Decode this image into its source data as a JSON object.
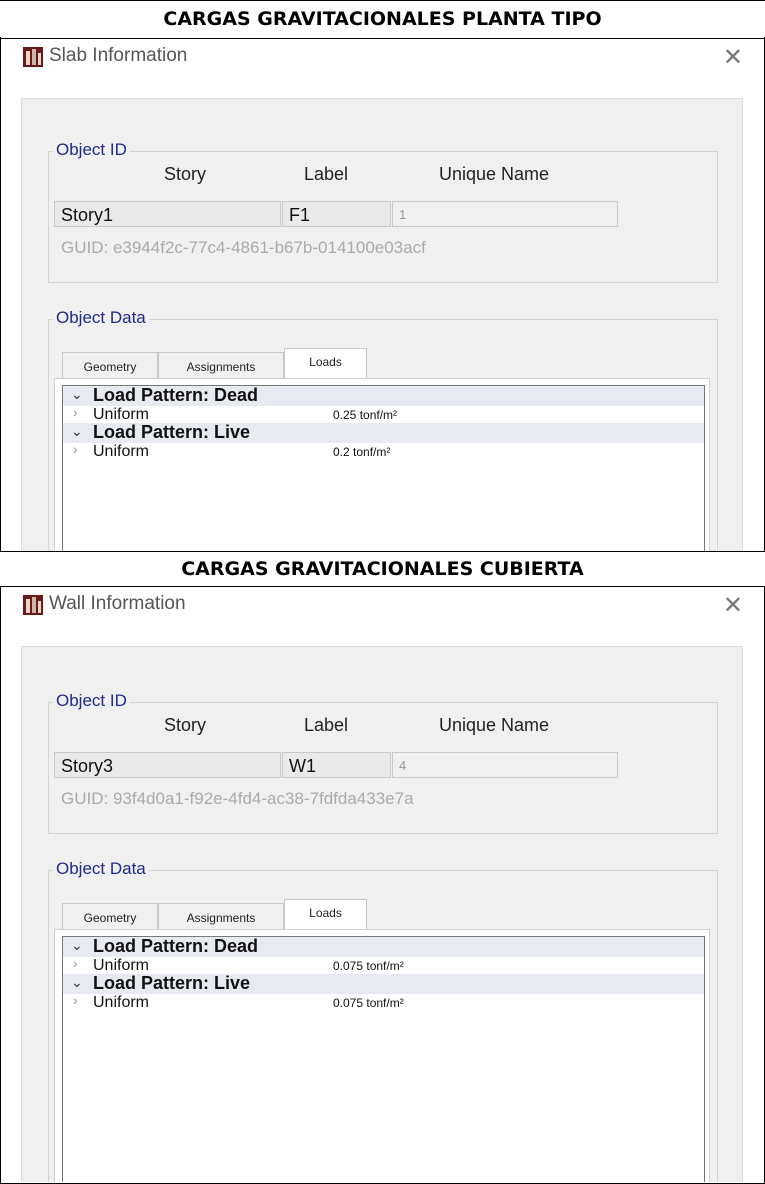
{
  "sections": [
    {
      "header": "CARGAS GRAVITACIONALES PLANTA TIPO",
      "window_title": "Slab Information",
      "close_glyph": "✕",
      "object_id": {
        "group_title": "Object ID",
        "col_story": "Story",
        "col_label": "Label",
        "col_unique": "Unique Name",
        "story": "Story1",
        "label": "F1",
        "unique_name": "1",
        "guid": "GUID:  e3944f2c-77c4-4861-b67b-014100e03acf"
      },
      "object_data": {
        "group_title": "Object Data",
        "tabs": [
          "Geometry",
          "Assignments",
          "Loads"
        ],
        "active_tab": "Loads",
        "rows": [
          {
            "type": "pattern",
            "text": "Load Pattern: Dead"
          },
          {
            "type": "item",
            "text": "Uniform",
            "value": "0.25 tonf/m²"
          },
          {
            "type": "pattern",
            "text": "Load Pattern: Live"
          },
          {
            "type": "item",
            "text": "Uniform",
            "value": "0.2 tonf/m²"
          }
        ]
      }
    },
    {
      "header": "CARGAS GRAVITACIONALES CUBIERTA",
      "window_title": "Wall Information",
      "close_glyph": "✕",
      "object_id": {
        "group_title": "Object ID",
        "col_story": "Story",
        "col_label": "Label",
        "col_unique": "Unique Name",
        "story": "Story3",
        "label": "W1",
        "unique_name": "4",
        "guid": "GUID:  93f4d0a1-f92e-4fd4-ac38-7fdfda433e7a"
      },
      "object_data": {
        "group_title": "Object Data",
        "tabs": [
          "Geometry",
          "Assignments",
          "Loads"
        ],
        "active_tab": "Loads",
        "rows": [
          {
            "type": "pattern",
            "text": "Load Pattern: Dead"
          },
          {
            "type": "item",
            "text": "Uniform",
            "value": "0.075 tonf/m²"
          },
          {
            "type": "pattern",
            "text": "Load Pattern: Live"
          },
          {
            "type": "item",
            "text": "Uniform",
            "value": "0.075 tonf/m²"
          }
        ]
      }
    }
  ]
}
